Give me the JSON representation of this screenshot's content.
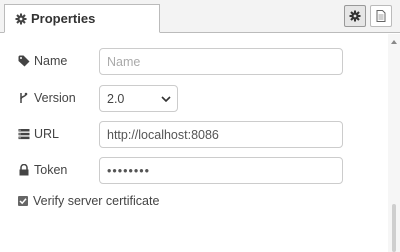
{
  "tabs": {
    "properties_label": "Properties"
  },
  "toolbar": {
    "settings_icon": "gear-icon",
    "docs_icon": "document-icon"
  },
  "form": {
    "name": {
      "label": "Name",
      "value": "",
      "placeholder": "Name",
      "icon": "tag-icon"
    },
    "version": {
      "label": "Version",
      "selected": "2.0",
      "icon": "branch-icon"
    },
    "url": {
      "label": "URL",
      "value": "http://localhost:8086",
      "icon": "server-icon"
    },
    "token": {
      "label": "Token",
      "value": "••••••••",
      "icon": "lock-icon"
    },
    "verify": {
      "label": "Verify server certificate",
      "checked": true
    }
  },
  "colors": {
    "tab_bg": "#ffffff",
    "tabbar_bg": "#f3f3f3",
    "border": "#cccccc",
    "checkbox": "#666666"
  }
}
